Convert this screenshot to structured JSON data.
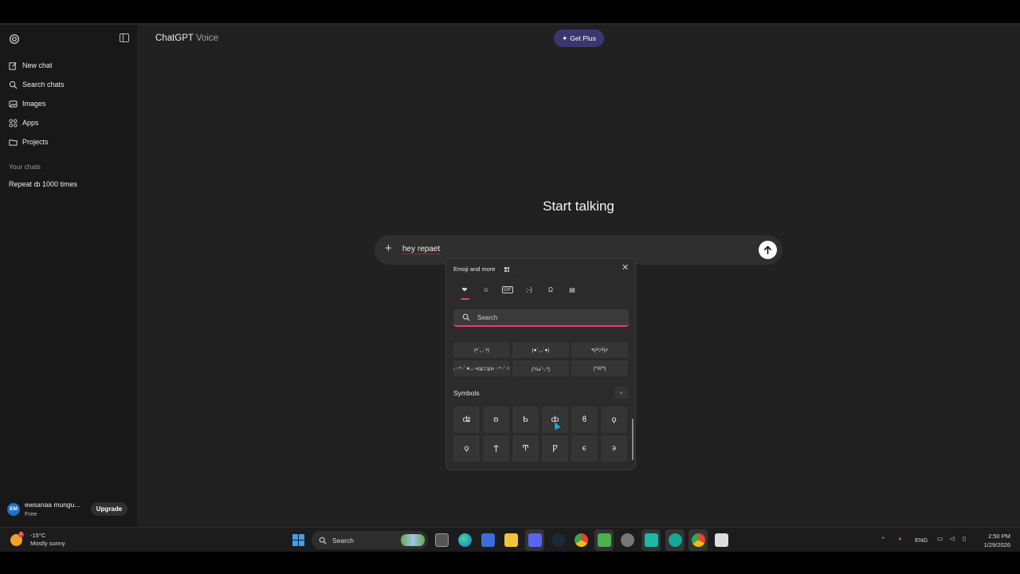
{
  "app": {
    "title": "ChatGPT",
    "subtitle": "Voice",
    "get_plus_label": "Get Plus"
  },
  "sidebar": {
    "items": [
      {
        "label": "New chat",
        "icon": "edit-icon"
      },
      {
        "label": "Search chats",
        "icon": "search-icon"
      },
      {
        "label": "Images",
        "icon": "images-icon"
      },
      {
        "label": "Apps",
        "icon": "apps-icon"
      },
      {
        "label": "Projects",
        "icon": "folder-icon"
      }
    ],
    "section_label": "Your chats",
    "chats": [
      "Repeat ȸ 1000 times"
    ]
  },
  "user": {
    "initials": "EM",
    "name": "ewsanaa mungu...",
    "plan": "Free",
    "upgrade_label": "Upgrade"
  },
  "main": {
    "heading": "Start talking",
    "composer_text": "hey repaet"
  },
  "emoji_panel": {
    "title": "Emoji and more",
    "search_placeholder": "Search",
    "kaomoji": [
      "(•`◡´•)",
      "(●´◡`●)",
      "٩(•̀▽•́)۶",
      "｡･:*:･ﾟ★,｡･o(≧▽≦)o ･:*:･ﾟ☆",
      "(*/ω＼*)",
      "(^///^)"
    ],
    "symbols_label": "Symbols",
    "symbols": [
      "ʥ",
      "ʚ",
      "Ƅ",
      "ȸ",
      "ϐ",
      "ϙ",
      "ϙ",
      "Ϯ",
      "Ͳ",
      "Ƿ",
      "ϵ",
      "϶"
    ]
  },
  "taskbar": {
    "temperature": "-15°C",
    "weather": "Mostly sunny",
    "weather_badge": "1",
    "search_label": "Search",
    "language": "ENG",
    "time": "2:50 PM",
    "date": "1/29/2026"
  },
  "colors": {
    "accent": "#e0417a",
    "plus_pill": "#3b3670",
    "sidebar_bg": "#181818",
    "main_bg": "#212121"
  }
}
